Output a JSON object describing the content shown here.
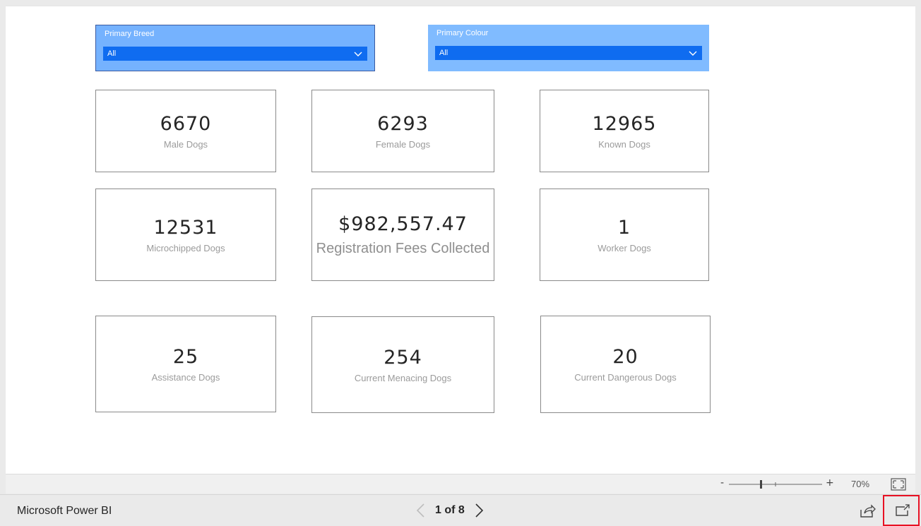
{
  "slicers": {
    "breed": {
      "title": "Primary Breed",
      "value": "All"
    },
    "colour": {
      "title": "Primary Colour",
      "value": "All"
    }
  },
  "cards": [
    {
      "value": "6670",
      "label": "Male Dogs"
    },
    {
      "value": "6293",
      "label": "Female Dogs"
    },
    {
      "value": "12965",
      "label": "Known Dogs"
    },
    {
      "value": "12531",
      "label": "Microchipped Dogs"
    },
    {
      "value": "$982,557.47",
      "label": "Registration Fees Collected"
    },
    {
      "value": "1",
      "label": "Worker Dogs"
    },
    {
      "value": "25",
      "label": "Assistance Dogs"
    },
    {
      "value": "254",
      "label": "Current Menacing Dogs"
    },
    {
      "value": "20",
      "label": "Current Dangerous Dogs"
    }
  ],
  "zoom": {
    "minus": "-",
    "plus": "+",
    "percent": "70%"
  },
  "footer": {
    "brand": "Microsoft Power BI",
    "page_info": "1 of 8"
  },
  "colors": {
    "slicer_breed_bg": "#75b2fe",
    "slicer_colour_bg": "#80bbff",
    "slicer_select": "#0f6cf0",
    "highlight": "#e81123"
  }
}
